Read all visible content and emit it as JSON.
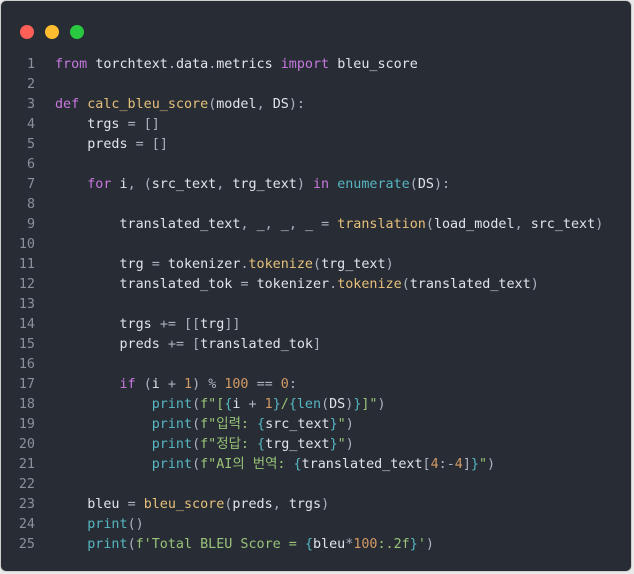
{
  "window": {
    "controls": [
      "close",
      "minimize",
      "maximize"
    ],
    "colors": {
      "background": "#282c34",
      "close": "#ff5f57",
      "minimize": "#febc2e",
      "maximize": "#28c840"
    }
  },
  "code": {
    "language": "python",
    "lines": [
      "from torchtext.data.metrics import bleu_score",
      "",
      "def calc_bleu_score(model, DS):",
      "    trgs = []",
      "    preds = []",
      "",
      "    for i, (src_text, trg_text) in enumerate(DS):",
      "",
      "        translated_text, _, _, _ = translation(load_model, src_text)",
      "",
      "        trg = tokenizer.tokenize(trg_text)",
      "        translated_tok = tokenizer.tokenize(translated_text)",
      "",
      "        trgs += [[trg]]",
      "        preds += [translated_tok]",
      "",
      "        if (i + 1) % 100 == 0:",
      "            print(f\"[{i + 1}/{len(DS)}]\")",
      "            print(f\"입력: {src_text}\")",
      "            print(f\"정답: {trg_text}\")",
      "            print(f\"AI의 번역: {translated_text[4:-4]}\")",
      "",
      "    bleu = bleu_score(preds, trgs)",
      "    print()",
      "    print(f'Total BLEU Score = {bleu*100:.2f}')"
    ]
  }
}
